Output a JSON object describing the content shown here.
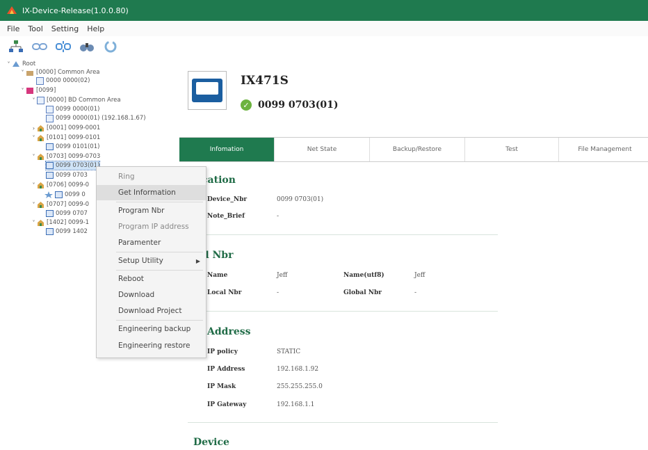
{
  "window": {
    "title": "IX-Device-Release(1.0.0.80)"
  },
  "menu": [
    "File",
    "Tool",
    "Setting",
    "Help"
  ],
  "toolbar": [
    "network-icon",
    "link-icon",
    "unlink-icon",
    "binoculars-icon",
    "refresh-icon"
  ],
  "tree": [
    {
      "label": "Root"
    },
    {
      "label": "[0000] Common Area"
    },
    {
      "label": "0000 0000(02)"
    },
    {
      "label": "[0099]"
    },
    {
      "label": "[0000] BD Common Area"
    },
    {
      "label": "0099 0000(01)"
    },
    {
      "label": "0099 0000(01) (192.168.1.67)"
    },
    {
      "label": "[0001] 0099-0001"
    },
    {
      "label": "[0101] 0099-0101"
    },
    {
      "label": "0099 0101(01)"
    },
    {
      "label": "[0703] 0099-0703"
    },
    {
      "label": "0099 0703(01)"
    },
    {
      "label": "0099 0703"
    },
    {
      "label": "[0706] 0099-0"
    },
    {
      "label": "0099 0"
    },
    {
      "label": "[0707] 0099-0"
    },
    {
      "label": "0099 0707"
    },
    {
      "label": "[1402] 0099-1"
    },
    {
      "label": "0099 1402"
    }
  ],
  "device": {
    "model": "IX471S",
    "number": "0099 0703(01)"
  },
  "tabs": [
    "Infomation",
    "Net State",
    "Backup/Restore",
    "Test",
    "File Management"
  ],
  "sections": {
    "location": {
      "title": "cation",
      "device_nbr_label": "Device_Nbr",
      "device_nbr": "0099 0703(01)",
      "note_label": "Note_Brief",
      "note": "-"
    },
    "call_nbr": {
      "title": "ll Nbr",
      "name_label": "Name",
      "name": "Jeff",
      "name_utf8_label": "Name(utf8)",
      "name_utf8": "Jeff",
      "local_label": "Local Nbr",
      "local": "-",
      "global_label": "Global Nbr",
      "global": "-"
    },
    "ip": {
      "title": "Address",
      "policy_label": "IP policy",
      "policy": "STATIC",
      "address_label": "IP Address",
      "address": "192.168.1.92",
      "mask_label": "IP Mask",
      "mask": "255.255.255.0",
      "gateway_label": "IP Gateway",
      "gateway": "192.168.1.1"
    },
    "device": {
      "title": "Device"
    }
  },
  "context_menu": [
    "Ring",
    "Get Information",
    "Program Nbr",
    "Program IP address",
    "Paramenter",
    "Setup Utility",
    "Reboot",
    "Download",
    "Download Project",
    "Engineering backup",
    "Engineering restore"
  ]
}
